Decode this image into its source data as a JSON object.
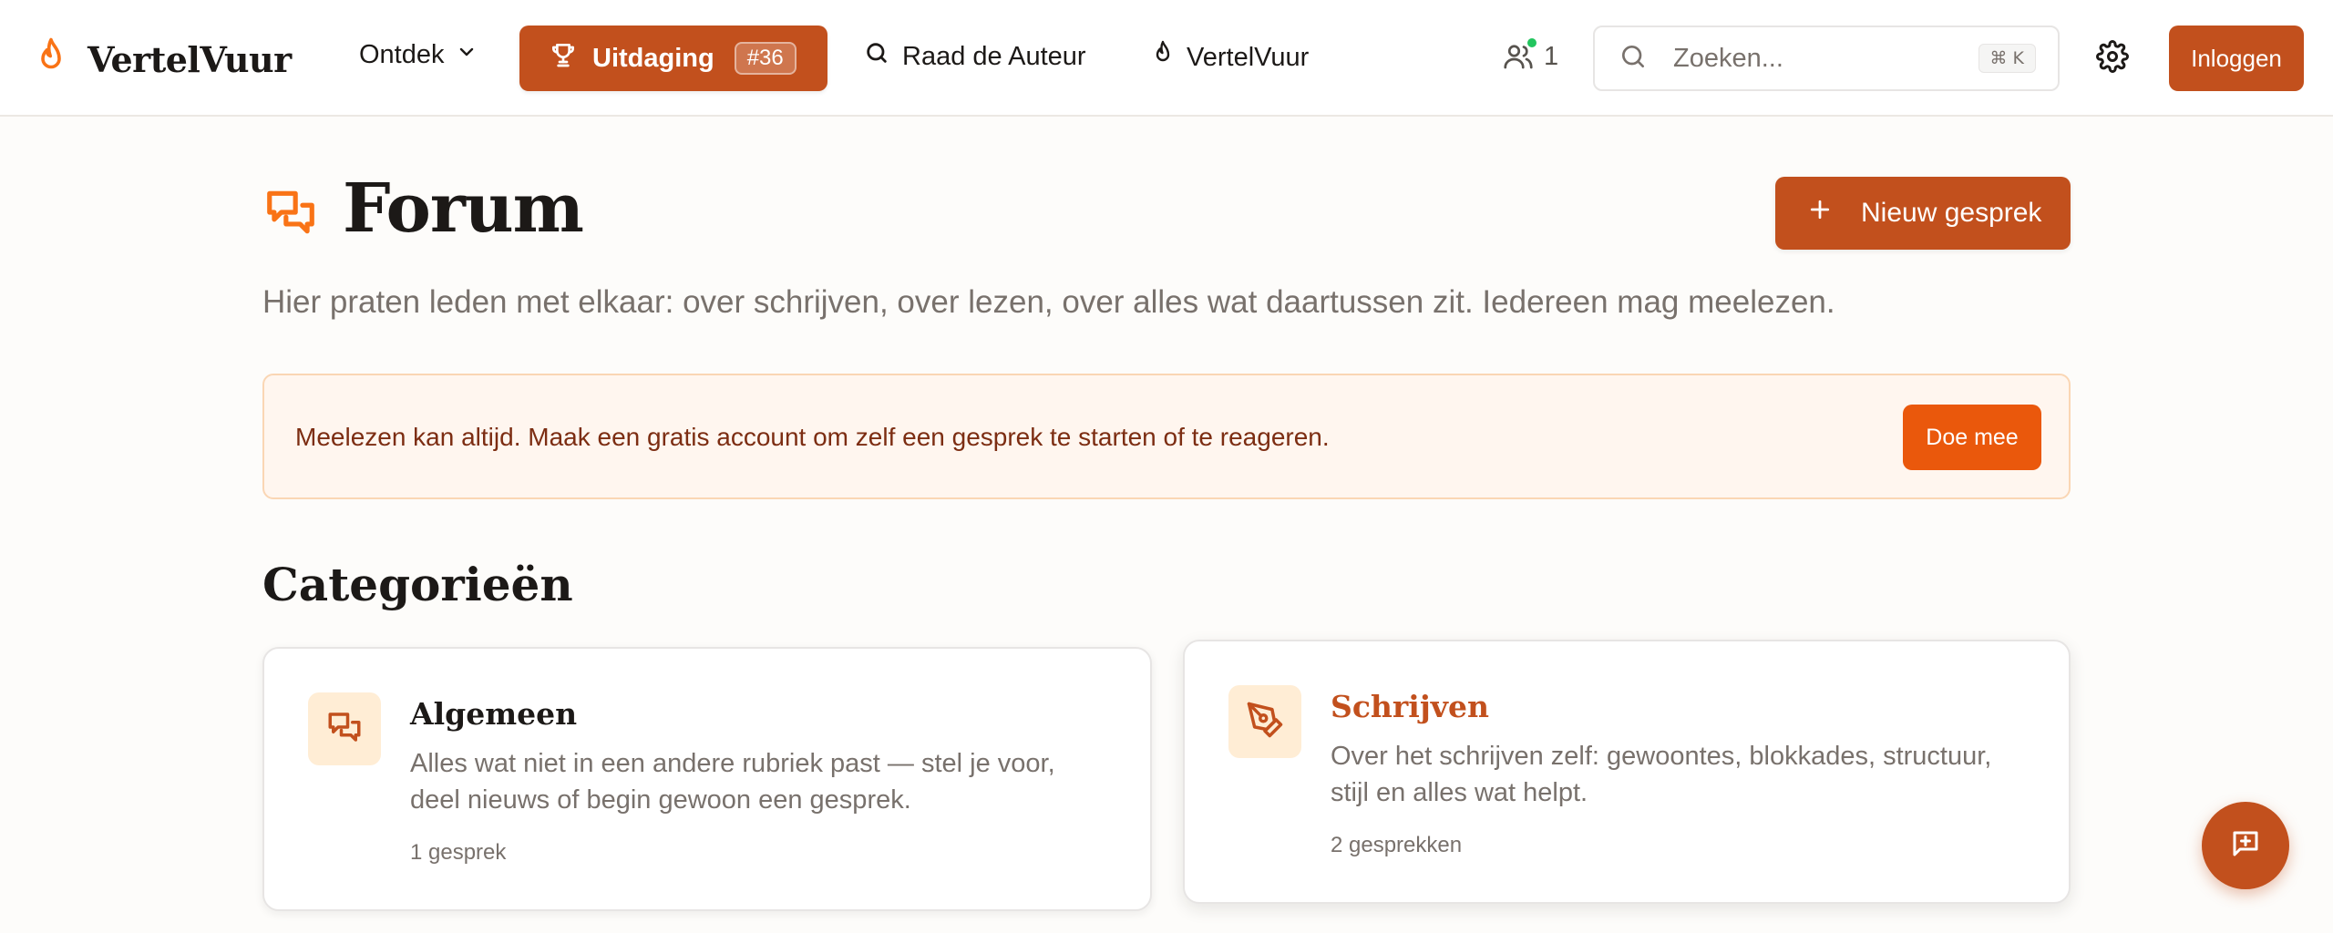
{
  "app": {
    "name": "VertelVuur",
    "accent": "#c2501d",
    "accent_bright": "#ea580c"
  },
  "header": {
    "logo_icon": "flame-icon",
    "nav_ontdek": "Ontdek",
    "challenge": {
      "label": "Uitdaging",
      "badge": "#36",
      "icon": "trophy-icon"
    },
    "nav_guess": "Raad de Auteur",
    "nav_vertelvuur": "VertelVuur",
    "online_count": "1",
    "search": {
      "placeholder": "Zoeken...",
      "shortcut": "⌘ K"
    },
    "login_label": "Inloggen"
  },
  "page": {
    "title": "Forum",
    "subtitle": "Hier praten leden met elkaar: over schrijven, over lezen, over alles wat daartussen zit. Iedereen mag meelezen.",
    "new_button": "Nieuw gesprek"
  },
  "notice": {
    "text": "Meelezen kan altijd. Maak een gratis account om zelf een gesprek te starten of te reageren.",
    "button": "Doe mee"
  },
  "categories": {
    "title": "Categorieën",
    "items": [
      {
        "name": "Algemeen",
        "description": "Alles wat niet in een andere rubriek past — stel je voor, deel nieuws of begin gewoon een gesprek.",
        "count": "1 gesprek",
        "icon": "chat-bubbles-icon"
      },
      {
        "name": "Schrijven",
        "description": "Over het schrijven zelf: gewoontes, blokkades, structuur, stijl en alles wat helpt.",
        "count": "2 gesprekken",
        "icon": "pen-nib-icon"
      }
    ]
  }
}
